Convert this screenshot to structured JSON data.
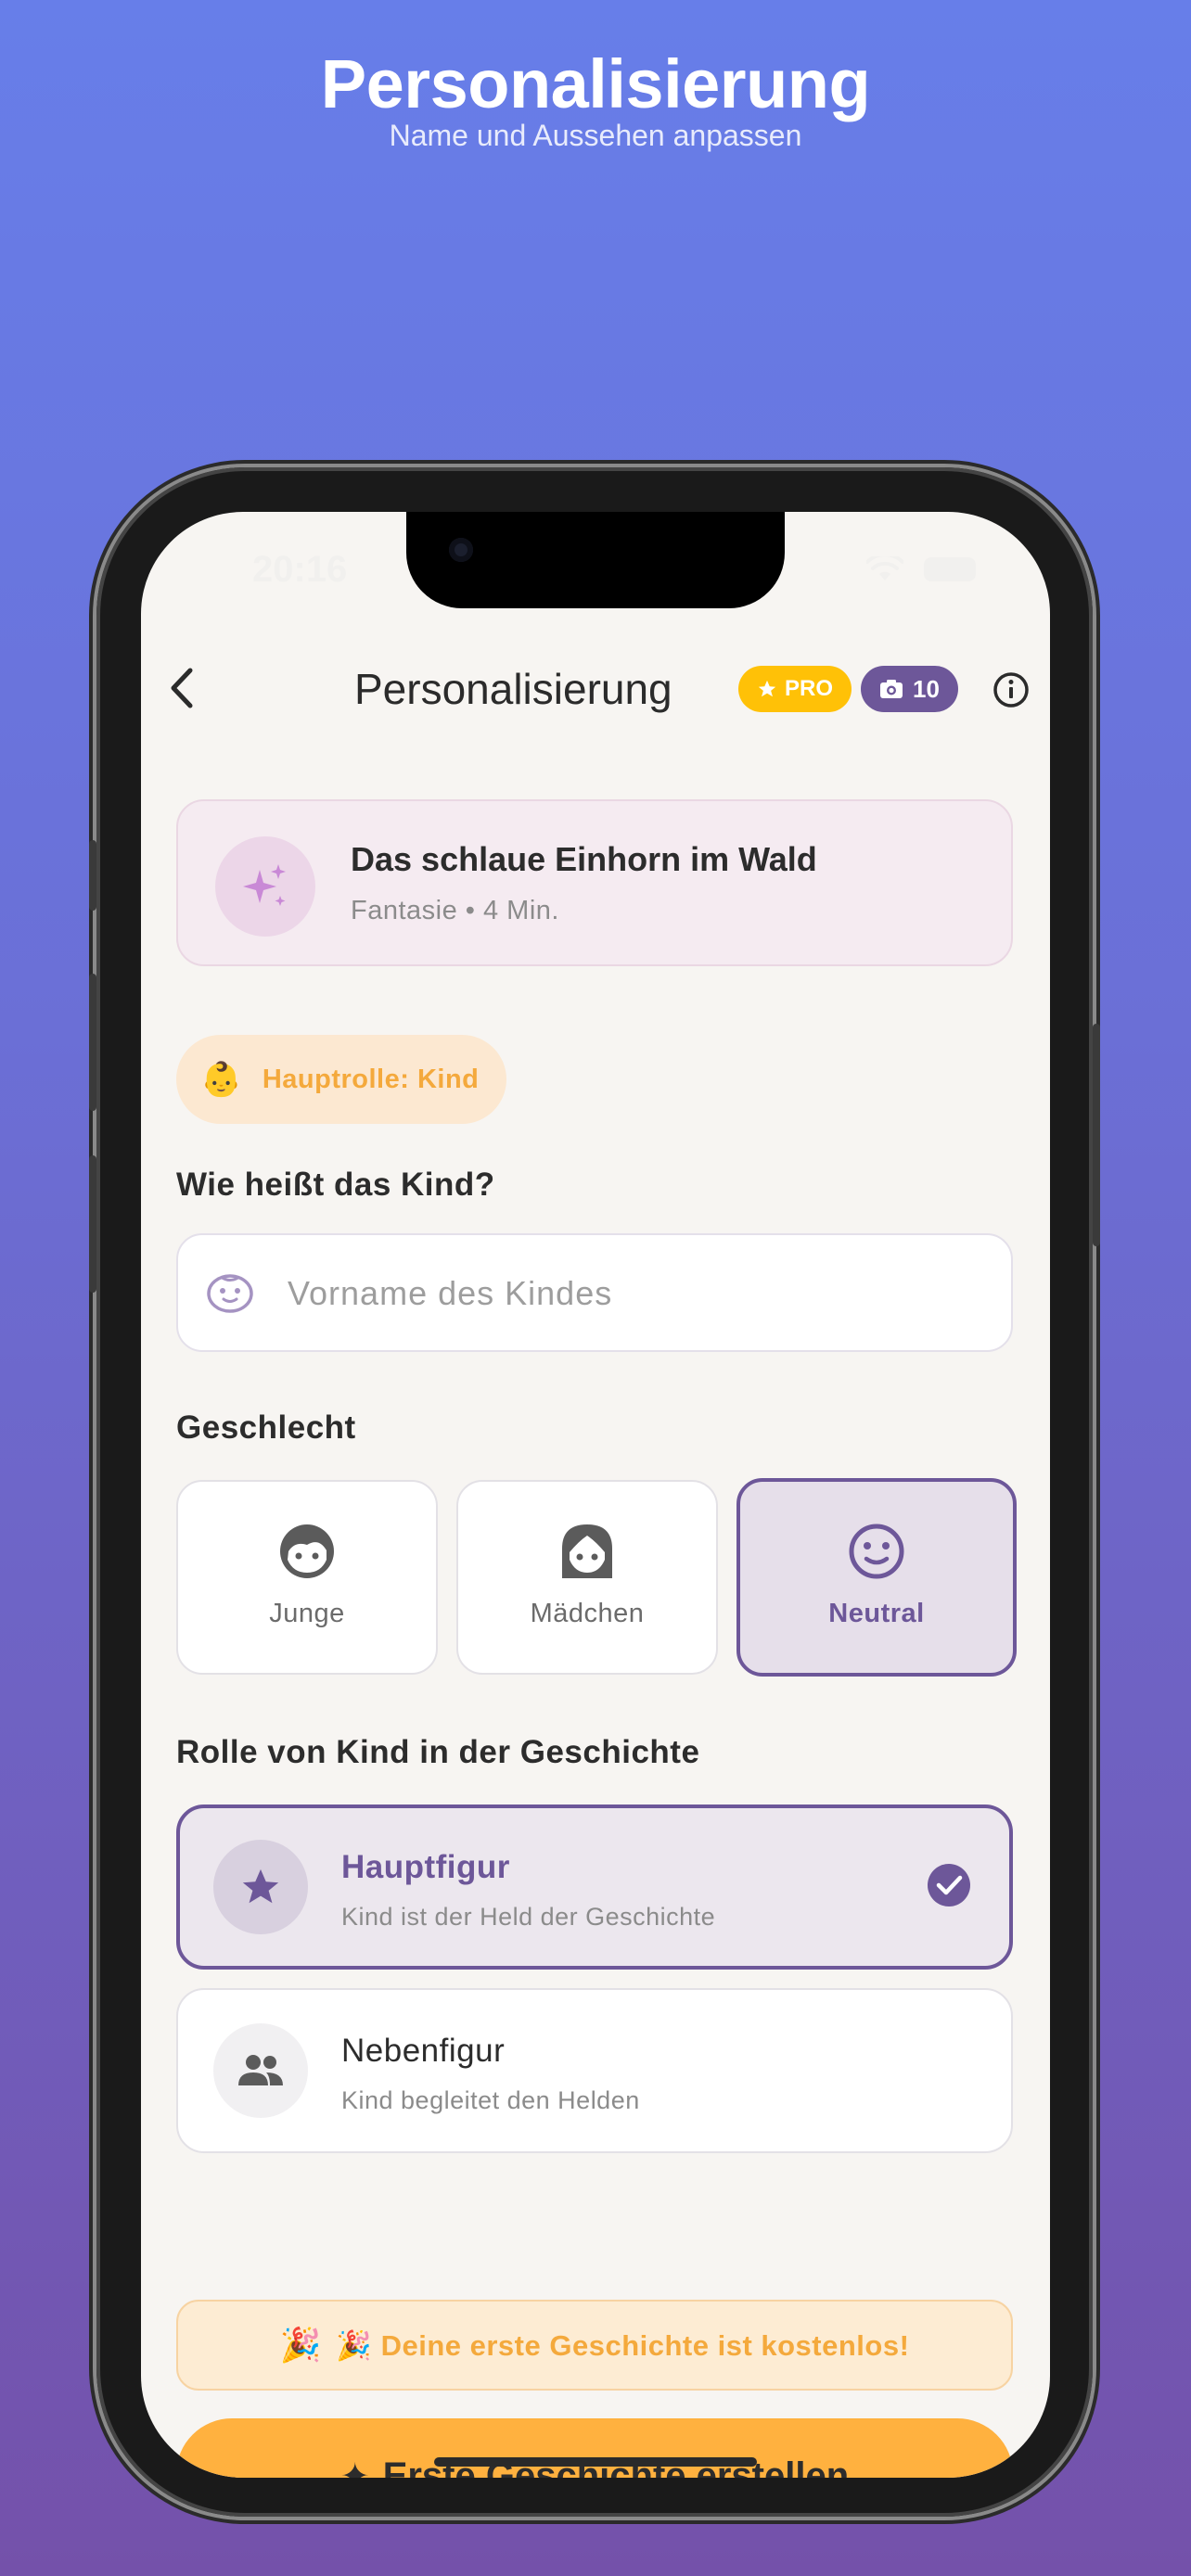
{
  "promo": {
    "title": "Personalisierung",
    "subtitle": "Name und Aussehen anpassen"
  },
  "statusbar": {
    "time": "20:16"
  },
  "nav": {
    "title": "Personalisierung",
    "pro_badge": "PRO",
    "photo_count": "10"
  },
  "story": {
    "title": "Das schlaue Einhorn im Wald",
    "meta": "Fantasie • 4 Min."
  },
  "role_chip": {
    "emoji": "👶",
    "label": "Hauptrolle: Kind"
  },
  "name_section": {
    "label": "Wie heißt das Kind?",
    "placeholder": "Vorname des Kindes",
    "value": ""
  },
  "gender_section": {
    "label": "Geschlecht",
    "options": [
      {
        "label": "Junge",
        "icon": "boy-face-icon",
        "selected": false
      },
      {
        "label": "Mädchen",
        "icon": "girl-face-icon",
        "selected": false
      },
      {
        "label": "Neutral",
        "icon": "neutral-face-icon",
        "selected": true
      }
    ]
  },
  "role_section": {
    "label": "Rolle von Kind in der Geschichte",
    "options": [
      {
        "title": "Hauptfigur",
        "description": "Kind ist der Held der Geschichte",
        "icon": "star-icon",
        "selected": true
      },
      {
        "title": "Nebenfigur",
        "description": "Kind begleitet den Helden",
        "icon": "group-icon",
        "selected": false
      }
    ]
  },
  "banner": {
    "icon": "🎉",
    "text": "🎉 Deine erste Geschichte ist kostenlos!"
  },
  "cta": {
    "icon": "✦",
    "label": "Erste Geschichte erstellen"
  },
  "colors": {
    "accent": "#6d5799",
    "pro": "#ffc107",
    "orange": "#ffb13f",
    "background": "#f7f5f2"
  }
}
